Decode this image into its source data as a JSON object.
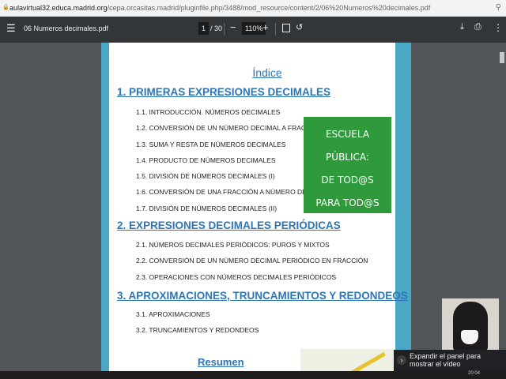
{
  "address_bar": {
    "url_host": "aulavirtual32.educa.madrid.org",
    "url_path": "/cepa.orcasitas.madrid/pluginfile.php/3488/mod_resource/content/2/06%20Numeros%20decimales.pdf"
  },
  "toolbar": {
    "title": "06 Numeros decimales.pdf",
    "page": "1",
    "page_total": "/ 30",
    "zoom": "110%"
  },
  "document": {
    "index_title": "Índice",
    "sections": [
      {
        "title": "1. PRIMERAS EXPRESIONES DECIMALES",
        "items": [
          "1.1. INTRODUCCIÓN. NÚMEROS DECIMALES",
          "1.2. CONVERSIÓN DE UN NÚMERO DECIMAL A FRACCIÓN",
          "1.3. SUMA Y RESTA DE NÚMEROS DECIMALES",
          "1.4. PRODUCTO DE NÚMEROS DECIMALES",
          "1.5. DIVISIÓN DE NÚMEROS DECIMALES (I)",
          "1.6. CONVERSIÓN DE UNA FRACCIÓN A NÚMERO DECIMAL",
          "1.7. DIVISIÓN DE NÚMEROS DECIMALES (II)"
        ]
      },
      {
        "title": "2. EXPRESIONES DECIMALES PERIÓDICAS",
        "items": [
          "2.1. NÚMEROS DECIMALES PERIÓDICOS: PUROS Y MIXTOS",
          "2.2. CONVERSIÓN DE UN NÚMERO DECIMAL PERIÓDICO EN FRACCIÓN",
          "2.3. OPERACIONES CON NÚMEROS DECIMALES PERIÓDICOS"
        ]
      },
      {
        "title": "3. APROXIMACIONES, TRUNCAMIENTOS Y REDONDEOS",
        "items": [
          "3.1. APROXIMACIONES",
          "3.2. TRUNCAMIENTOS Y REDONDEOS"
        ]
      }
    ],
    "summary_title": "Resumen",
    "poster": {
      "line1": "ESCUELA PÚBLICA:",
      "line2": "DE TOD@S",
      "line3": "PARA TOD@S"
    }
  },
  "video_tooltip": "Expandir el panel para mostrar el vídeo",
  "taskbar": {
    "clock": "20:04"
  }
}
